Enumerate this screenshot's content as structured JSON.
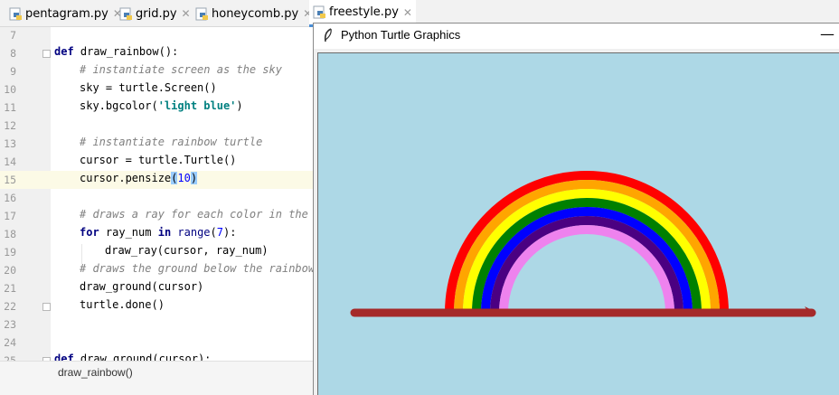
{
  "tabs": [
    {
      "label": "pentagram.py",
      "active": false
    },
    {
      "label": "grid.py",
      "active": false
    },
    {
      "label": "honeycomb.py",
      "active": false
    },
    {
      "label": "freestyle.py",
      "active": true
    }
  ],
  "editor": {
    "line_numbers": [
      "7",
      "8",
      "9",
      "10",
      "11",
      "12",
      "13",
      "14",
      "15",
      "16",
      "17",
      "18",
      "19",
      "20",
      "21",
      "22",
      "23",
      "24",
      "25"
    ],
    "lines": {
      "l8_def": "def",
      "l8_name": " draw_rainbow():",
      "l9": "# instantiate screen as the sky",
      "l10": "sky = turtle.Screen()",
      "l11_a": "sky.bgcolor(",
      "l11_str": "'light blue'",
      "l11_b": ")",
      "l13": "# instantiate rainbow turtle",
      "l14": "cursor = turtle.Turtle()",
      "l15_a": "cursor.pensize",
      "l15_p1": "(",
      "l15_num": "10",
      "l15_p2": ")",
      "l17": "# draws a ray for each color in the r",
      "l18_for": "for",
      "l18_mid": " ray_num ",
      "l18_in": "in",
      "l18_sp": " ",
      "l18_range": "range",
      "l18_open": "(",
      "l18_num": "7",
      "l18_close": "):",
      "l19": "draw_ray(cursor, ray_num)",
      "l20": "# draws the ground below the rainbow",
      "l21": "draw_ground(cursor)",
      "l22": "turtle.done()",
      "l25_def": "def",
      "l25_name": " draw_ground(cursor):"
    }
  },
  "breadcrumb": "draw_rainbow()",
  "turtle_window": {
    "title": "Python Turtle Graphics",
    "minimize": "—",
    "colors": {
      "sky": "#add8e6",
      "ground": "#a52a2a",
      "rays": [
        "#ff0000",
        "#ffa500",
        "#ffff00",
        "#008000",
        "#0000ff",
        "#4b0082",
        "#ee82ee"
      ]
    }
  }
}
